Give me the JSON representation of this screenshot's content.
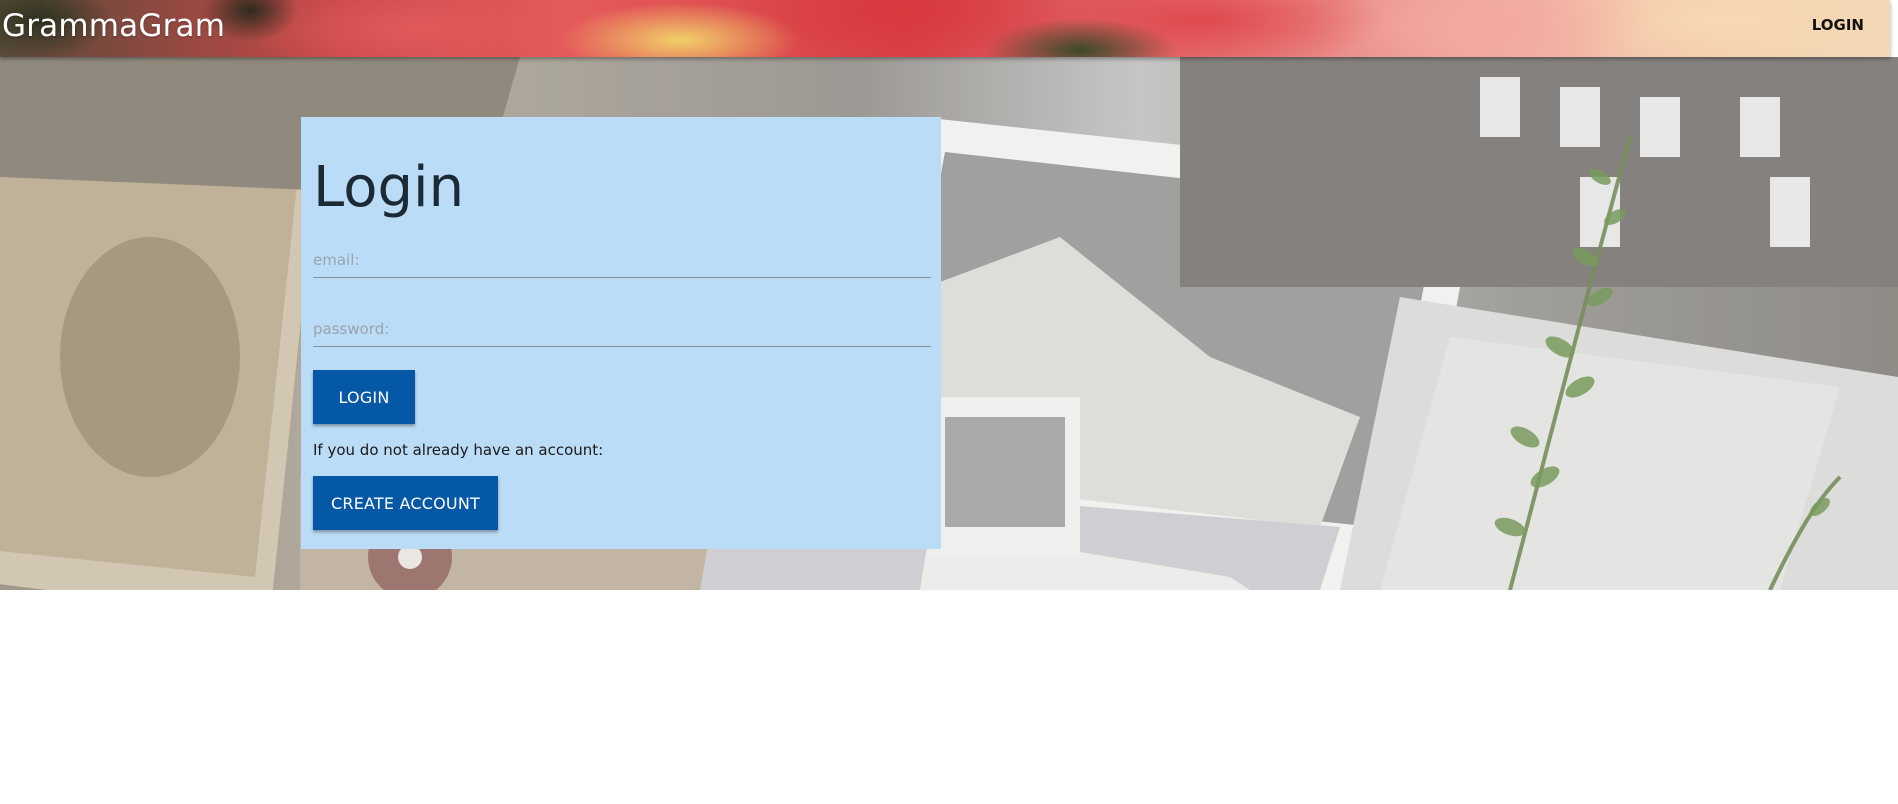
{
  "app": {
    "brand": "GrammaGram",
    "nav_login": "LOGIN"
  },
  "login_card": {
    "title": "Login",
    "email_placeholder": "email:",
    "password_placeholder": "password:",
    "login_button": "LOGIN",
    "signup_hint": "If you do not already have an account:",
    "create_account_button": "CREATE ACCOUNT"
  },
  "colors": {
    "card_background": "#bbdcf7",
    "button_background": "#0558a6",
    "button_text": "#ffffff",
    "brand_text": "#ffffff"
  }
}
